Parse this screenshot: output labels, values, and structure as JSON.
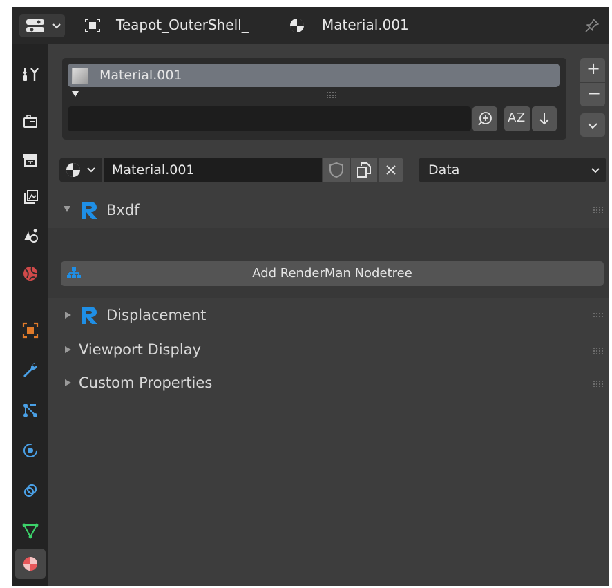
{
  "header": {
    "editor_type_icon": "properties-editor-icon",
    "object_icon": "object-data-icon",
    "object_name": "Teapot_OuterShell_",
    "material_icon": "material-icon",
    "material_name": "Material.001",
    "pin_icon": "pin-icon"
  },
  "tabs": [
    {
      "name": "tool",
      "icon": "tool-icon"
    },
    {
      "name": "render",
      "icon": "render-icon"
    },
    {
      "name": "output",
      "icon": "output-icon"
    },
    {
      "name": "view-layer",
      "icon": "view-layer-icon"
    },
    {
      "name": "scene",
      "icon": "scene-icon"
    },
    {
      "name": "world",
      "icon": "world-icon"
    },
    {
      "name": "object",
      "icon": "object-icon"
    },
    {
      "name": "modifiers",
      "icon": "wrench-icon"
    },
    {
      "name": "particles",
      "icon": "particles-icon"
    },
    {
      "name": "physics",
      "icon": "physics-icon"
    },
    {
      "name": "constraints",
      "icon": "constraints-icon"
    },
    {
      "name": "object-data",
      "icon": "mesh-data-icon"
    },
    {
      "name": "material",
      "icon": "material-icon",
      "active": true
    }
  ],
  "material_slots": {
    "items": [
      "Material.001"
    ],
    "filter_value": "",
    "add_label": "+",
    "remove_label": "−",
    "sort_label": "AZ"
  },
  "material_selector": {
    "name": "Material.001",
    "link_value": "Data"
  },
  "panels": {
    "bxdf": {
      "title": "Bxdf",
      "expanded": true,
      "button_label": "Add RenderMan Nodetree"
    },
    "displacement": {
      "title": "Displacement",
      "expanded": false
    },
    "viewport_display": {
      "title": "Viewport Display",
      "expanded": false
    },
    "custom_properties": {
      "title": "Custom Properties",
      "expanded": false
    }
  },
  "colors": {
    "renderman_blue": "#1f8fe6",
    "material_tab": "#e8575a",
    "world_red": "#d24a4a",
    "object_orange": "#e07a2a",
    "modifier_blue": "#4aa0e6",
    "data_green": "#3cd26a"
  }
}
